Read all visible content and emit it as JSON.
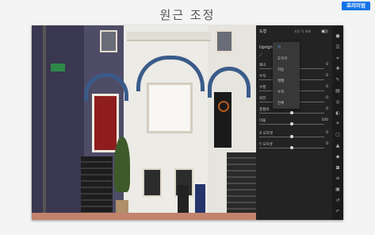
{
  "page": {
    "title": "원근 조정",
    "premium_label": "프리미엄"
  },
  "panel": {
    "header": "도형",
    "toggle_label": "자동 각 해제",
    "upright_label": "Upright",
    "dropdown": {
      "items": [
        "꺼",
        "도우미",
        "자동",
        "레벨",
        "수직",
        "전체"
      ],
      "selected_index": 0
    },
    "sliders": [
      {
        "label": "왜곡",
        "value": "0",
        "fraction": 0.5
      },
      {
        "label": "수직",
        "value": "0",
        "fraction": 0.5
      },
      {
        "label": "수평",
        "value": "0",
        "fraction": 0.5
      },
      {
        "label": "회전",
        "value": "0",
        "fraction": 0.5
      },
      {
        "label": "종횡비",
        "value": "0",
        "fraction": 0.5
      },
      {
        "label": "비율",
        "value": "100",
        "fraction": 0.5
      },
      {
        "label": "X 오프셋",
        "value": "0",
        "fraction": 0.5
      },
      {
        "label": "Y 오프셋",
        "value": "0",
        "fraction": 0.5
      }
    ]
  },
  "tools": [
    "circle-icon",
    "edit-sliders-icon",
    "crop-icon",
    "heal-icon",
    "brush-icon",
    "gradient-icon",
    "radial-icon",
    "color-icon",
    "sun-icon",
    "aspect-icon",
    "triangle-icon",
    "drop-icon",
    "geometry-icon",
    "preset-icon",
    "stack-icon",
    "history-icon",
    "undo-icon"
  ]
}
